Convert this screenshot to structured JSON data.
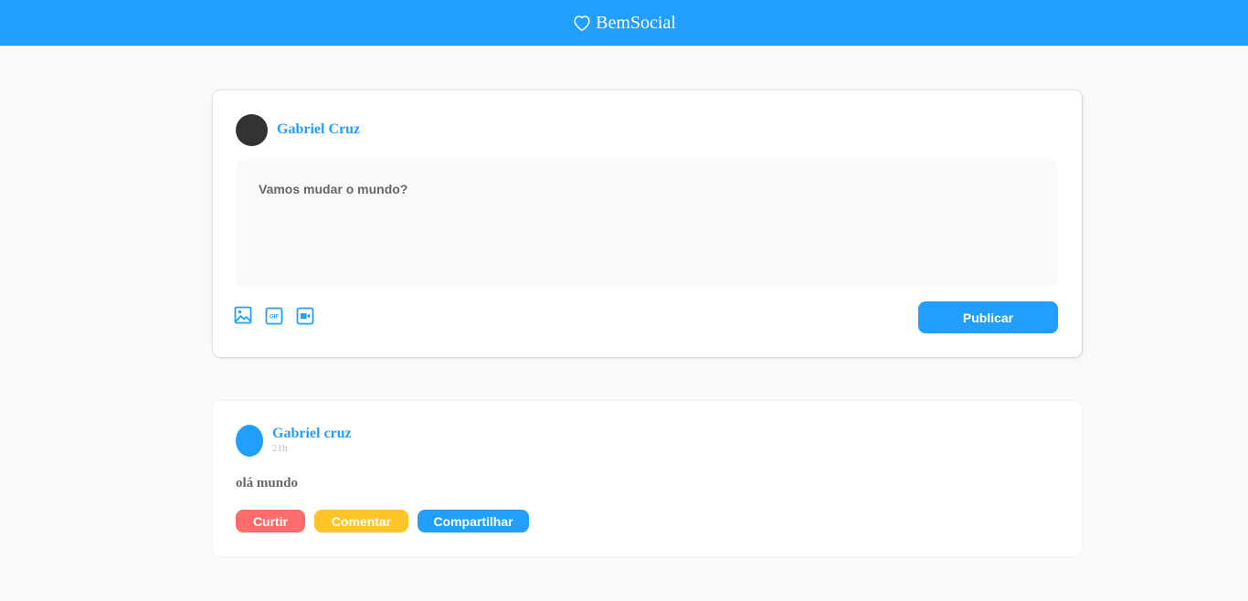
{
  "header": {
    "brand": "BemSocial",
    "icon": "heart-icon",
    "color": "#229ffe"
  },
  "composer": {
    "user_name": "Gabriel Cruz",
    "placeholder": "Vamos mudar o mundo?",
    "media_icons": [
      "image-icon",
      "gif-icon",
      "video-icon"
    ],
    "publish_label": "Publicar"
  },
  "posts": [
    {
      "user_name": "Gabriel cruz",
      "time": "21h",
      "content": "olá mundo",
      "actions": {
        "like": "Curtir",
        "comment": "Comentar",
        "share": "Compartilhar"
      }
    }
  ],
  "colors": {
    "primary": "#229ffe",
    "like": "#fe6c6c",
    "comment": "#fec42a",
    "share": "#229ffe"
  }
}
